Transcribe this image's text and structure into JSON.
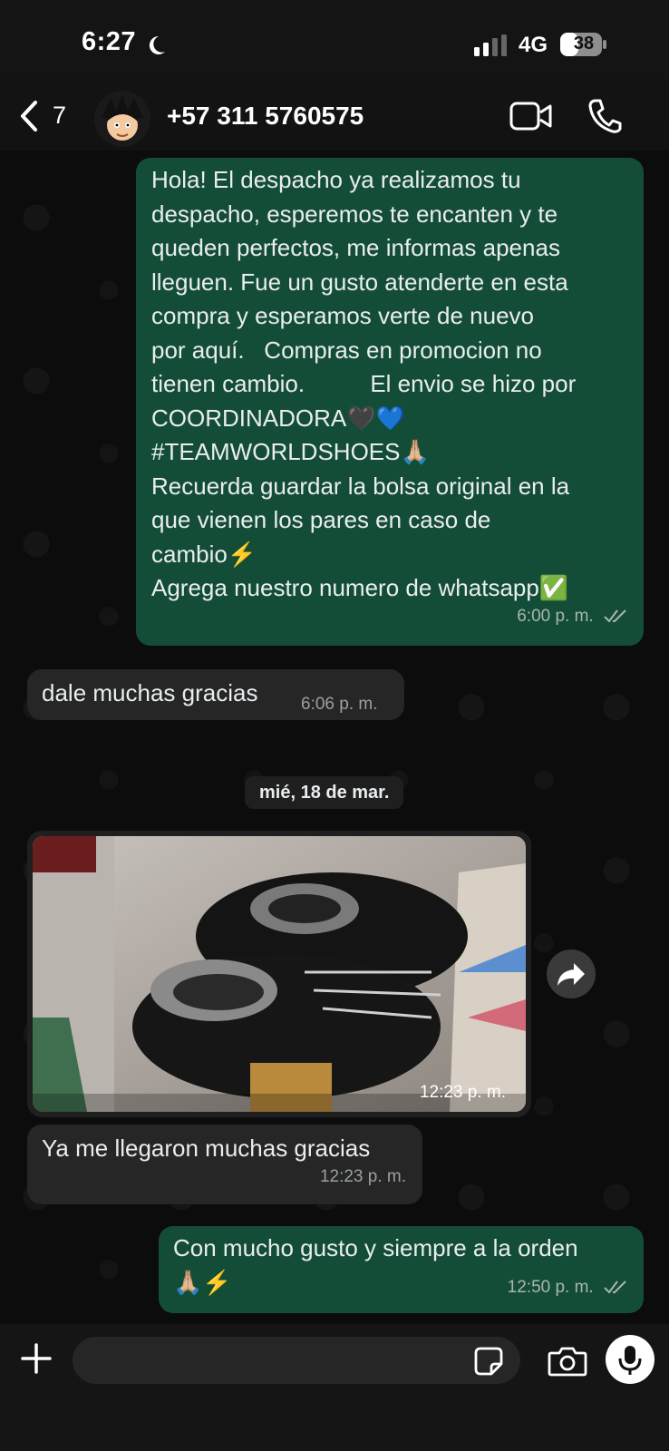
{
  "status_bar": {
    "time": "6:27",
    "network": "4G",
    "battery": "38"
  },
  "header": {
    "back_count": "7",
    "contact_name": "+57 311 5760575"
  },
  "messages": {
    "m1": {
      "text": "Hola! El despacho ya realizamos tu\ndespacho, esperemos te encanten y te\nqueden perfectos, me informas apenas\nlleguen. Fue un gusto atenderte en esta\ncompra y esperamos verte de nuevo\npor aquí.   Compras en promocion no\ntienen cambio.          El envio se hizo por\nCOORDINADORA🖤💙\n#TEAMWORLDSHOES🙏🏼\nRecuerda guardar la bolsa original en la\nque vienen los pares en caso de\ncambio⚡\nAgrega nuestro numero de whatsapp✅",
      "time": "6:00 p. m."
    },
    "m2": {
      "text": "dale muchas gracias",
      "time": "6:06 p. m."
    },
    "date_separator": "mié, 18 de mar.",
    "m3": {
      "time": "12:23 p. m."
    },
    "m4": {
      "text": "Ya me llegaron muchas gracias",
      "time": "12:23 p. m."
    },
    "m5": {
      "text": "Con mucho gusto y siempre a la orden\n🙏🏼⚡",
      "time": "12:50 p. m."
    }
  },
  "composer": {
    "placeholder": ""
  },
  "colors": {
    "outgoing_bubble": "#144d37",
    "incoming_bubble": "#262626",
    "background": "#0b0b0b"
  },
  "icons": [
    "back-icon",
    "avatar",
    "video-call-icon",
    "phone-call-icon",
    "forward-icon",
    "plus-icon",
    "sticker-icon",
    "camera-icon",
    "microphone-icon",
    "double-check-icon"
  ]
}
